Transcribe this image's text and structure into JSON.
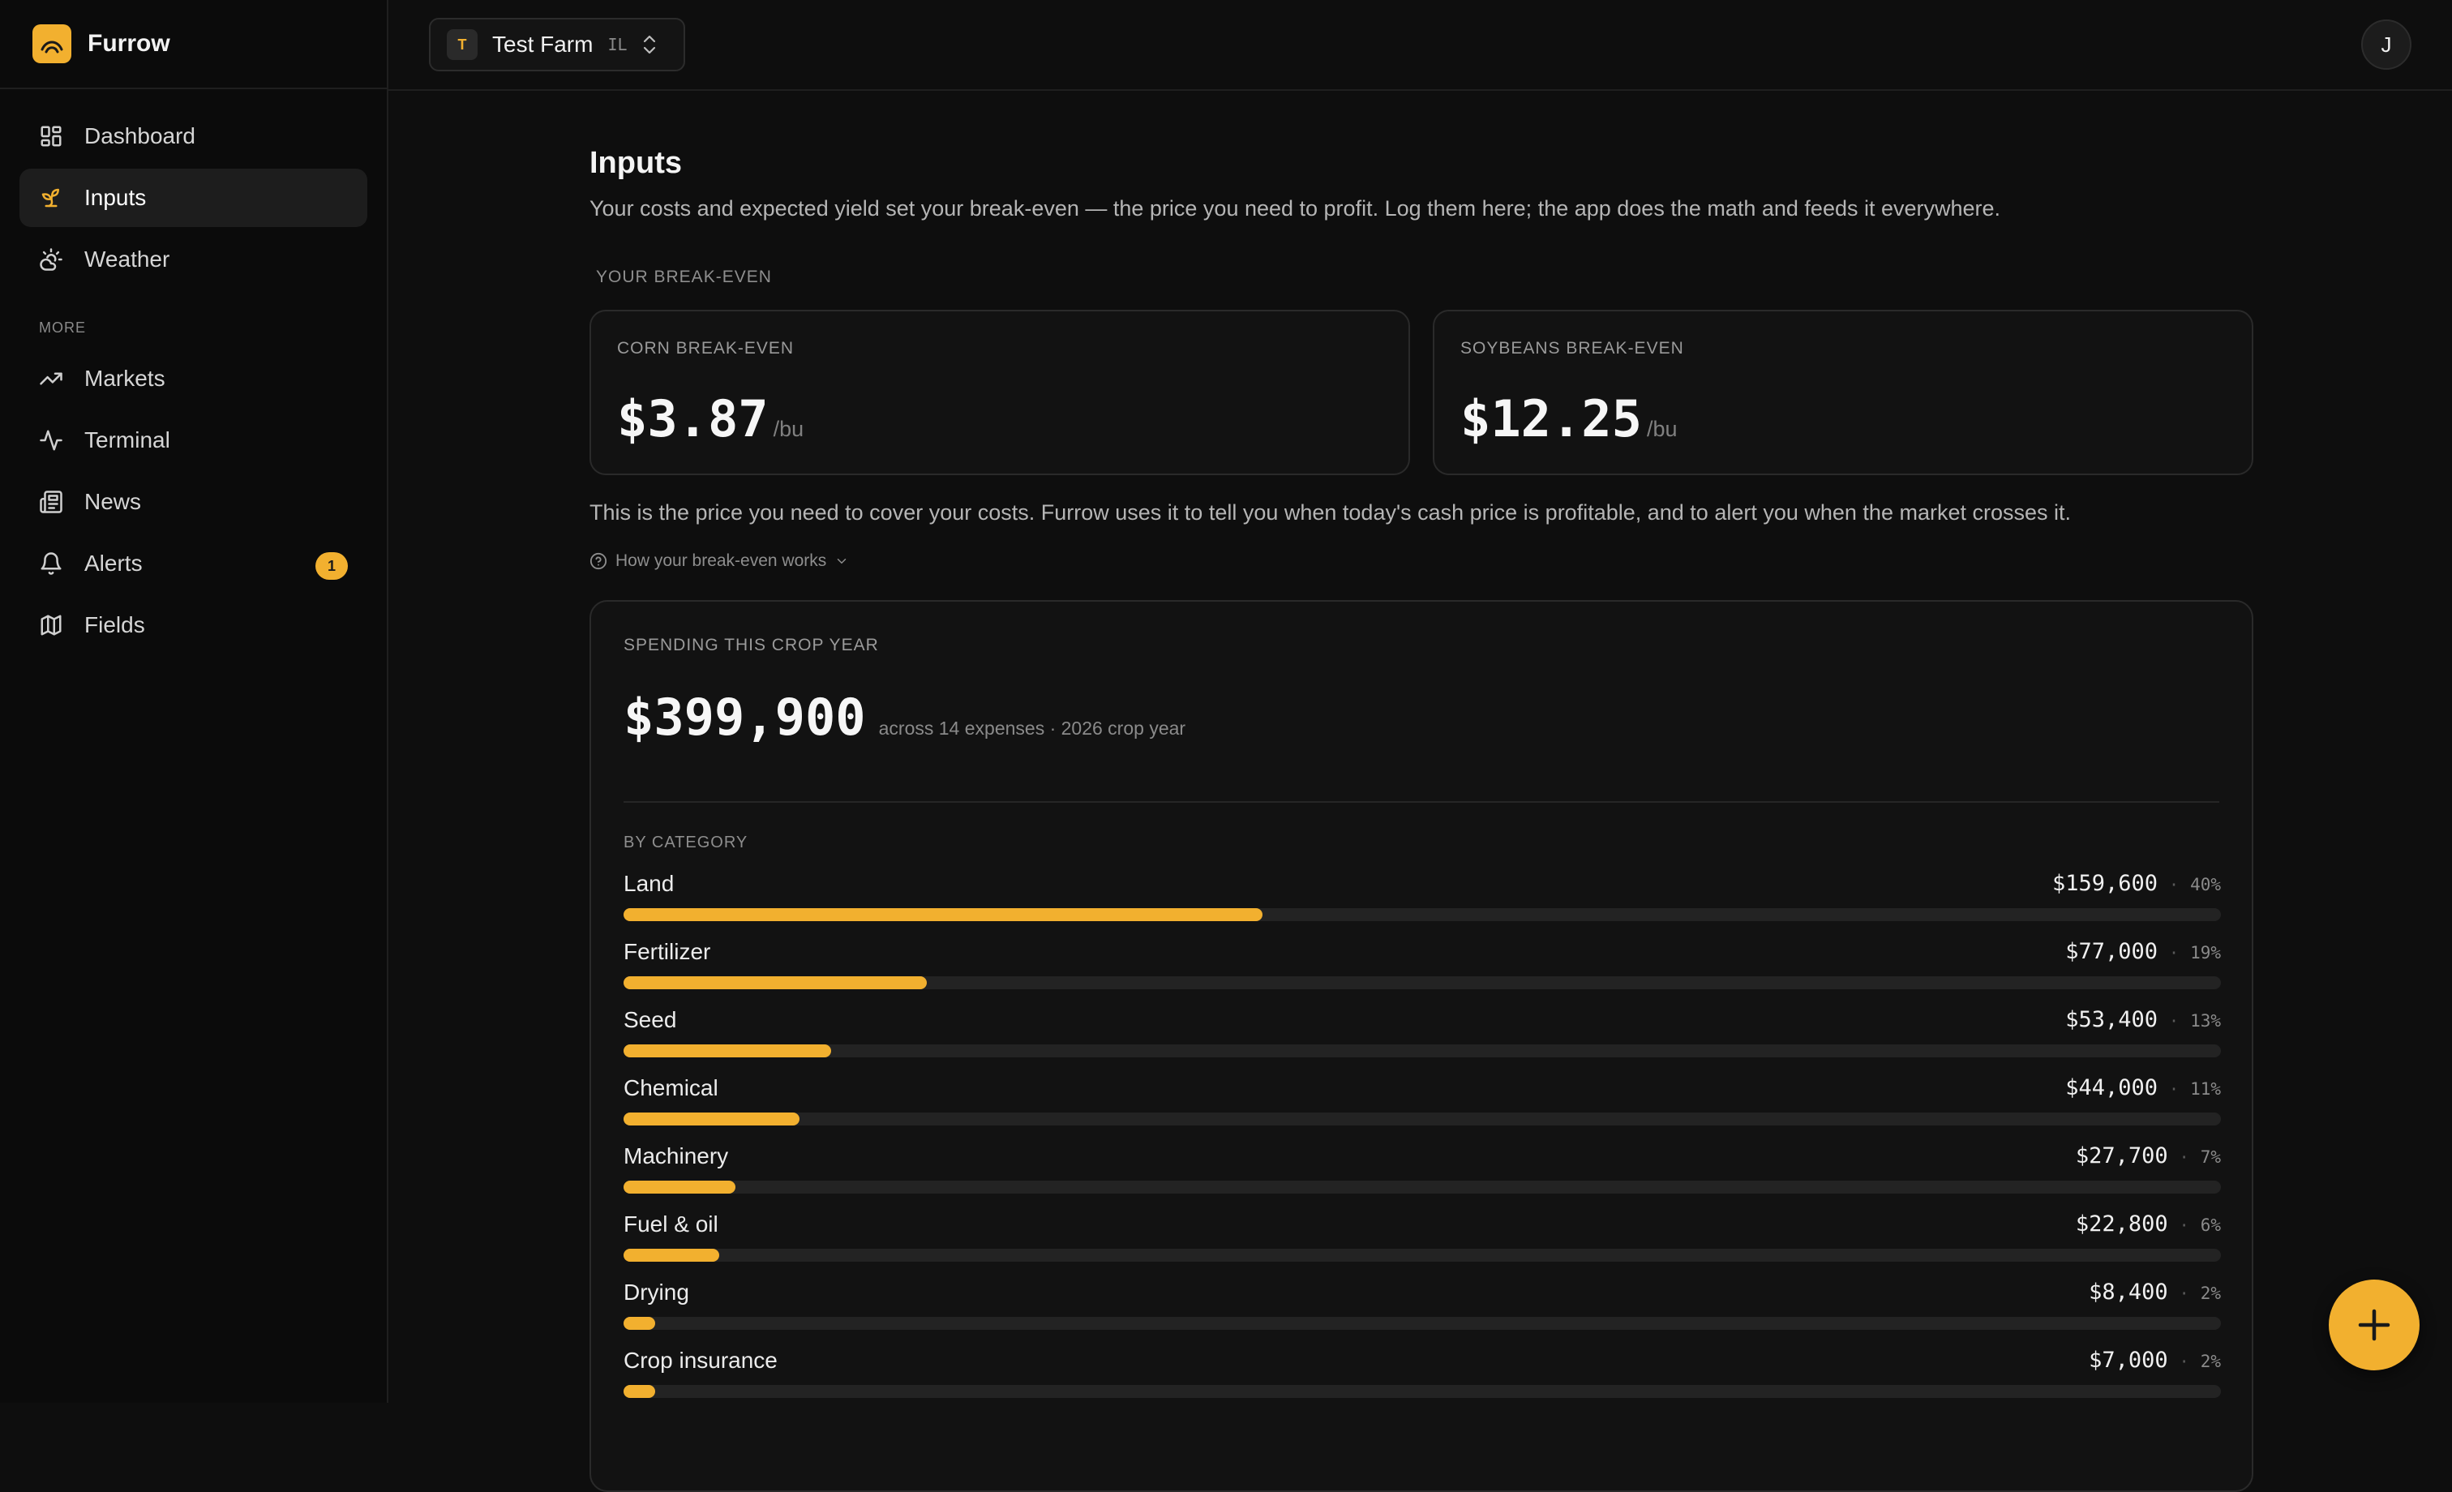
{
  "app": {
    "name": "Furrow"
  },
  "sidebar": {
    "items": [
      {
        "label": "Dashboard",
        "icon": "dashboard-icon"
      },
      {
        "label": "Inputs",
        "icon": "sprout-icon",
        "active": true
      },
      {
        "label": "Weather",
        "icon": "weather-icon"
      }
    ],
    "more_label": "MORE",
    "more_items": [
      {
        "label": "Markets",
        "icon": "trending-up-icon"
      },
      {
        "label": "Terminal",
        "icon": "activity-icon"
      },
      {
        "label": "News",
        "icon": "newspaper-icon"
      },
      {
        "label": "Alerts",
        "icon": "bell-icon",
        "badge": "1"
      },
      {
        "label": "Fields",
        "icon": "map-icon"
      }
    ]
  },
  "topbar": {
    "farm_initial": "T",
    "farm_name": "Test Farm",
    "farm_state": "IL",
    "avatar_initial": "J"
  },
  "page": {
    "title": "Inputs",
    "description": "Your costs and expected yield set your break-even — the price you need to profit. Log them here; the app does the math and feeds it everywhere.",
    "breakeven_section_label": "YOUR BREAK-EVEN",
    "breakeven_cards": [
      {
        "label": "CORN BREAK-EVEN",
        "value": "$3.87",
        "unit": "/bu"
      },
      {
        "label": "SOYBEANS BREAK-EVEN",
        "value": "$12.25",
        "unit": "/bu"
      }
    ],
    "note": "This is the price you need to cover your costs. Furrow uses it to tell you when today's cash price is profitable, and to alert you when the market crosses it.",
    "howto_label": "How your break-even works"
  },
  "spending": {
    "label": "SPENDING THIS CROP YEAR",
    "total": "$399,900",
    "subtitle": "across 14 expenses · 2026 crop year",
    "category_label": "BY CATEGORY",
    "categories": [
      {
        "name": "Land",
        "amount": "$159,600",
        "pct": "40%",
        "fraction": 0.4
      },
      {
        "name": "Fertilizer",
        "amount": "$77,000",
        "pct": "19%",
        "fraction": 0.19
      },
      {
        "name": "Seed",
        "amount": "$53,400",
        "pct": "13%",
        "fraction": 0.13
      },
      {
        "name": "Chemical",
        "amount": "$44,000",
        "pct": "11%",
        "fraction": 0.11
      },
      {
        "name": "Machinery",
        "amount": "$27,700",
        "pct": "7%",
        "fraction": 0.07
      },
      {
        "name": "Fuel & oil",
        "amount": "$22,800",
        "pct": "6%",
        "fraction": 0.06
      },
      {
        "name": "Drying",
        "amount": "$8,400",
        "pct": "2%",
        "fraction": 0.02
      },
      {
        "name": "Crop insurance",
        "amount": "$7,000",
        "pct": "2%",
        "fraction": 0.02
      }
    ]
  },
  "colors": {
    "accent": "#f2b02f",
    "background": "#0e0e0e",
    "card": "#121212"
  }
}
